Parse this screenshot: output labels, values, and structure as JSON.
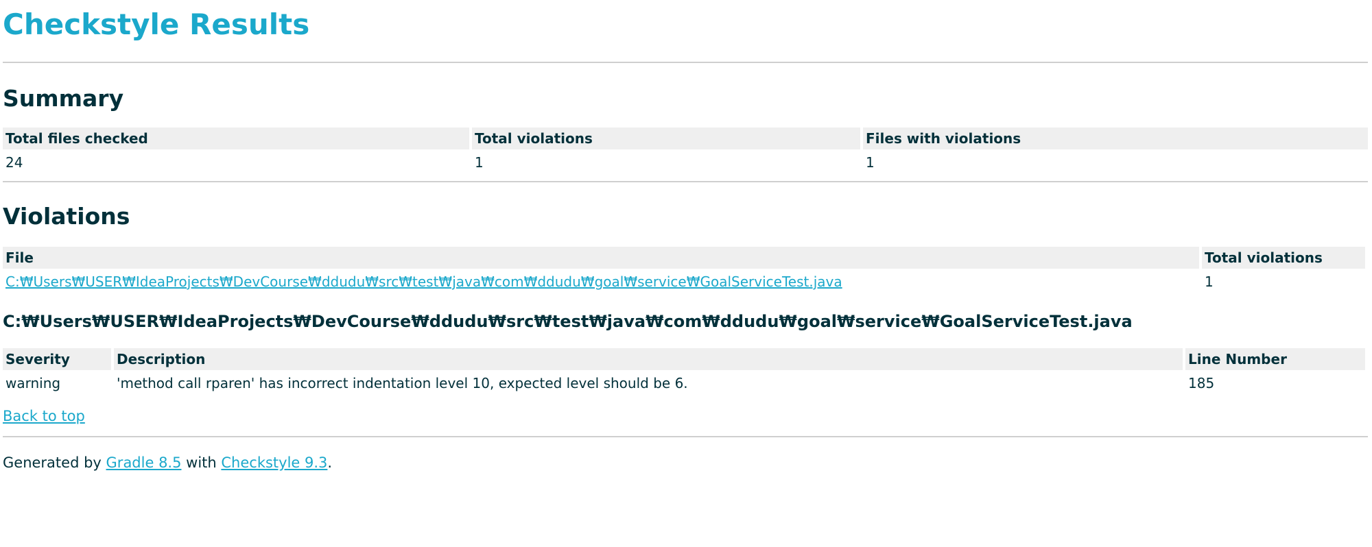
{
  "title": "Checkstyle Results",
  "summary": {
    "heading": "Summary",
    "headers": [
      "Total files checked",
      "Total violations",
      "Files with violations"
    ],
    "values": [
      "24",
      "1",
      "1"
    ]
  },
  "violations": {
    "heading": "Violations",
    "headers": [
      "File",
      "Total violations"
    ],
    "rows": [
      {
        "file": "C:₩Users₩USER₩IdeaProjects₩DevCourse₩ddudu₩src₩test₩java₩com₩ddudu₩goal₩service₩GoalServiceTest.java",
        "total": "1"
      }
    ]
  },
  "file_detail": {
    "heading": "C:₩Users₩USER₩IdeaProjects₩DevCourse₩ddudu₩src₩test₩java₩com₩ddudu₩goal₩service₩GoalServiceTest.java",
    "headers": [
      "Severity",
      "Description",
      "Line Number"
    ],
    "rows": [
      {
        "severity": "warning",
        "description": "'method call rparen' has incorrect indentation level 10, expected level should be 6.",
        "line": "185"
      }
    ]
  },
  "back_to_top": "Back to top",
  "footer": {
    "prefix": "Generated by ",
    "gradle_link": "Gradle 8.5",
    "middle": " with ",
    "checkstyle_link": "Checkstyle 9.3",
    "suffix": "."
  },
  "colors": {
    "title": "#1ba8cb",
    "text": "#02303a",
    "link": "#1ba8cb",
    "header_bg": "#efefef",
    "rule": "#cfcfcf"
  }
}
